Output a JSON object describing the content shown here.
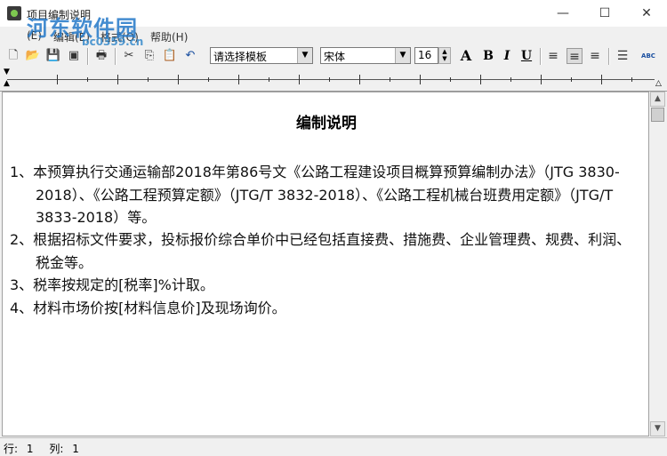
{
  "window": {
    "title": "项目编制说明",
    "watermark": "河东软件园",
    "watermark_url": "pc0359.cn",
    "minimize": "—",
    "maximize": "☐",
    "close": "✕"
  },
  "menu": {
    "items": [
      "(E)",
      "编辑(E)",
      "格式(O)",
      "帮助(H)"
    ]
  },
  "toolbar": {
    "template_select": "请选择模板",
    "font_select": "宋体",
    "font_size": "16",
    "bold": "B",
    "italic": "I",
    "underline": "U",
    "font_color": "A",
    "spell": "ABC"
  },
  "document": {
    "title": "编制说明",
    "paragraphs": [
      "1、本预算执行交通运输部2018年第86号文《公路工程建设项目概算预算编制办法》（JTG 3830-2018）、《公路工程预算定额》（JTG/T 3832-2018）、《公路工程机械台班费用定额》（JTG/T 3833-2018）等。",
      "2、根据招标文件要求，投标报价综合单价中已经包括直接费、措施费、企业管理费、规费、利润、税金等。",
      "3、税率按规定的[税率]%计取。",
      "4、材料市场价按[材料信息价]及现场询价。"
    ]
  },
  "status": {
    "row_label": "行:",
    "row_value": "1",
    "col_label": "列:",
    "col_value": "1"
  }
}
